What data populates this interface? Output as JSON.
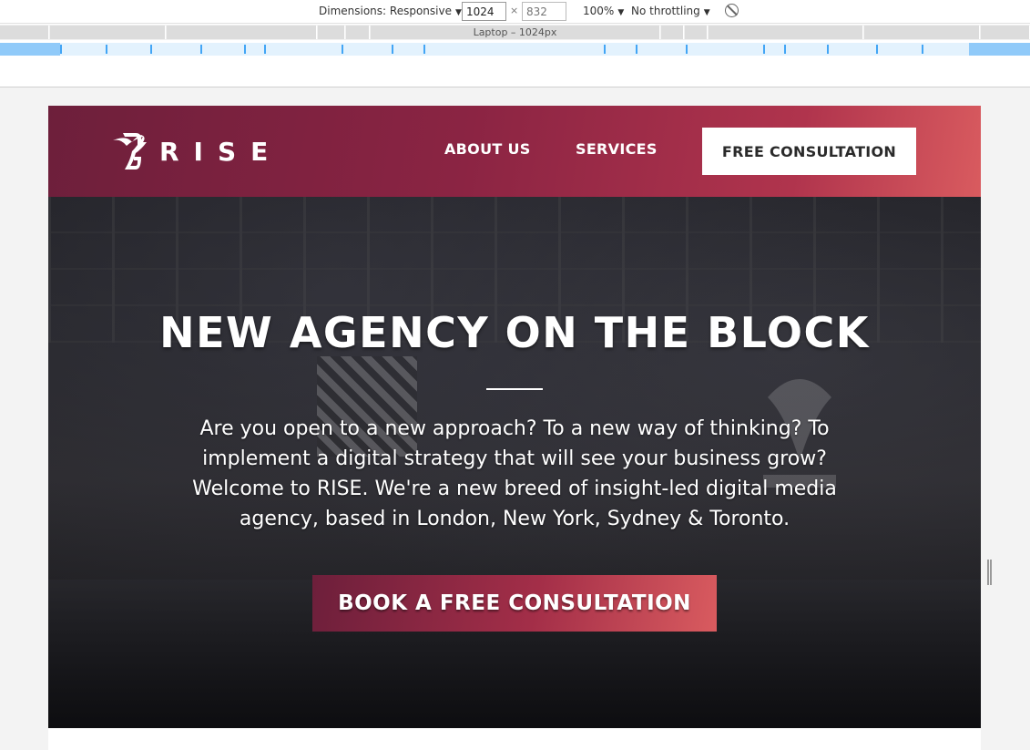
{
  "devtools": {
    "dimensions_label": "Dimensions: Responsive",
    "width_value": "1024",
    "height_placeholder": "832",
    "times_symbol": "×",
    "zoom": "100%",
    "throttling": "No throttling",
    "media_query_label": "Laptop – 1024px"
  },
  "site": {
    "brand": "RISE",
    "nav": {
      "about": "ABOUT US",
      "services": "SERVICES",
      "cta": "FREE CONSULTATION"
    },
    "hero": {
      "title": "NEW AGENCY ON THE BLOCK",
      "text": "Are you open to a new approach? To a new way of thinking? To implement a digital strategy that will see your business grow? Welcome to RISE. We're a new breed of insight-led digital media agency, based in London, New York, Sydney & Toronto.",
      "cta": "BOOK A FREE CONSULTATION"
    }
  },
  "colors": {
    "brand_dark": "#6d1f3b",
    "brand_mid": "#a32e48",
    "brand_light": "#d95b5f"
  },
  "icons": {
    "logo": "hummingbird-logo-icon",
    "rotate": "rotate-icon",
    "dropdown": "caret-down-icon"
  }
}
